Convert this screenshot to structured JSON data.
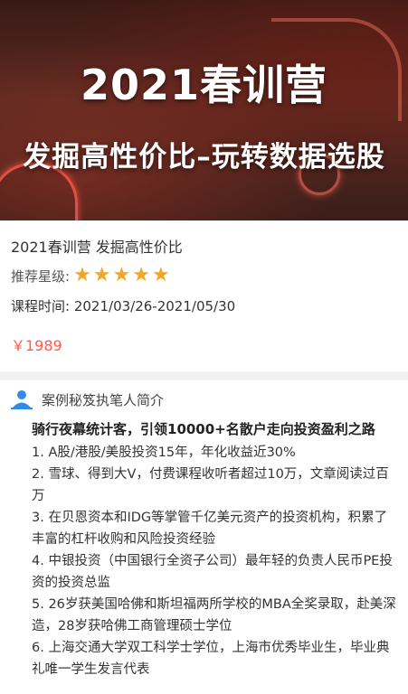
{
  "banner": {
    "title": "2021春训营",
    "subtitle": "发掘高性价比–玩转数据选股"
  },
  "course": {
    "name": "2021春训营 发掘高性价比",
    "rating_label": "推荐星级:",
    "rating_value": 5,
    "rating_max": 5,
    "time_label": "课程时间:",
    "time_value": "2021/03/26-2021/05/30",
    "price": "￥1989"
  },
  "section": {
    "icon": "user-icon",
    "title": "案例秘笈执笔人简介",
    "lead": "骑行夜幕统计客，引领10000+名散户走向投资盈利之路",
    "items": [
      "1. A股/港股/美股投资15年，年化收益近30%",
      "2. 雪球、得到大V，付费课程收听者超过10万，文章阅读过百万",
      "3. 在贝恩资本和IDG等掌管千亿美元资产的投资机构，积累了丰富的杠杆收购和风险投资经验",
      "4. 中银投资（中国银行全资子公司）最年轻的负责人民币PE投资的投资总监",
      "5. 26岁获美国哈佛和斯坦福两所学校的MBA全奖录取，赴美深造，28岁获哈佛工商管理硕士学位",
      "6. 上海交通大学双工科学士学位，上海市优秀毕业生，毕业典礼唯一学生发言代表"
    ]
  },
  "colors": {
    "price": "#ff5a4a",
    "star": "#f5a623",
    "icon": "#2f8be6"
  }
}
